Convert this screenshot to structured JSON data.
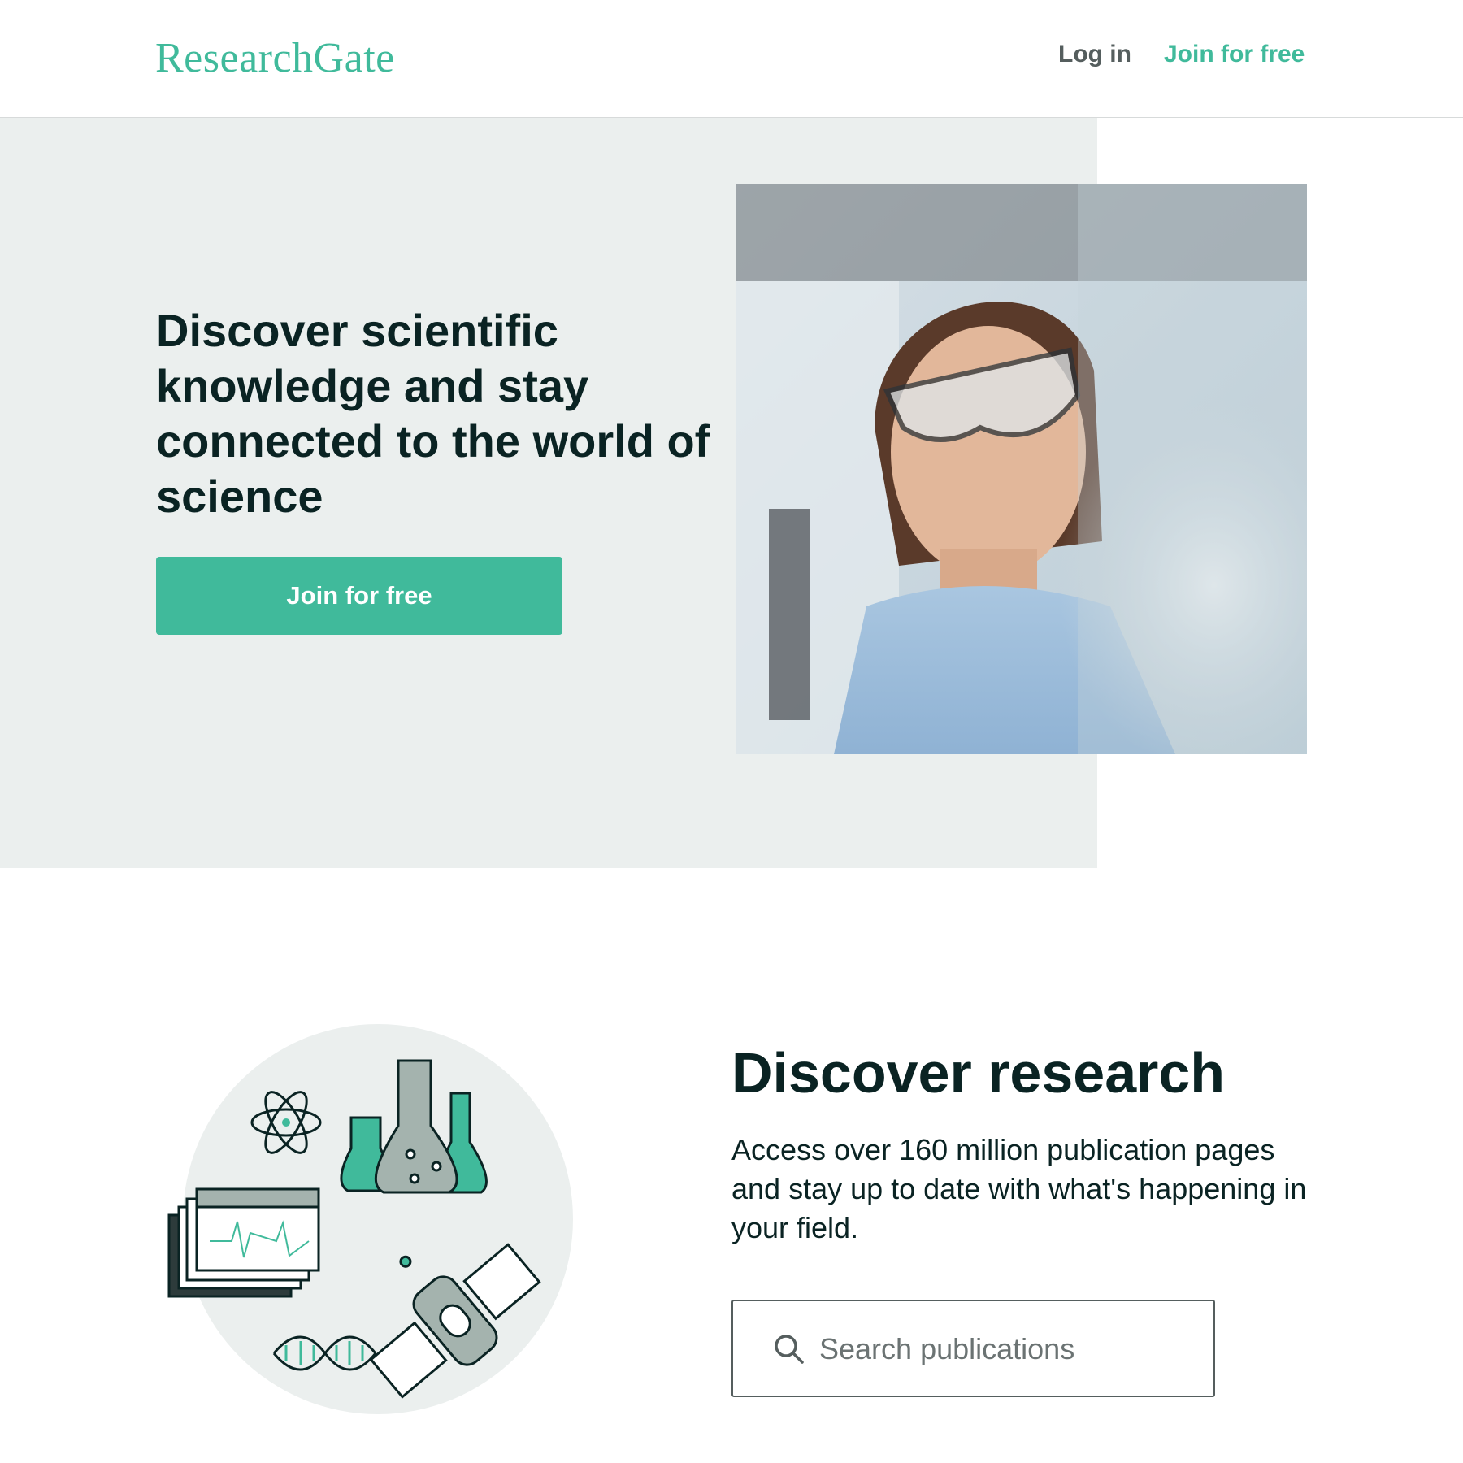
{
  "header": {
    "logo": "ResearchGate",
    "login_label": "Log in",
    "join_label": "Join for free"
  },
  "hero": {
    "title": "Discover scientific knowledge and stay connected to the world of science",
    "cta_label": "Join for free"
  },
  "discover": {
    "title": "Discover research",
    "text": "Access over 160 million publication pages and stay up to date with what's happening in your field.",
    "search_placeholder": "Search publications"
  },
  "colors": {
    "brand": "#40ba9b",
    "hero_bg": "#ebefee",
    "text_dark": "#0a2323",
    "nav_gray": "#555e5e"
  },
  "icons": [
    "search-icon",
    "atom-icon",
    "flask-icon",
    "monitor-window-icon",
    "satellite-icon",
    "dna-icon"
  ]
}
